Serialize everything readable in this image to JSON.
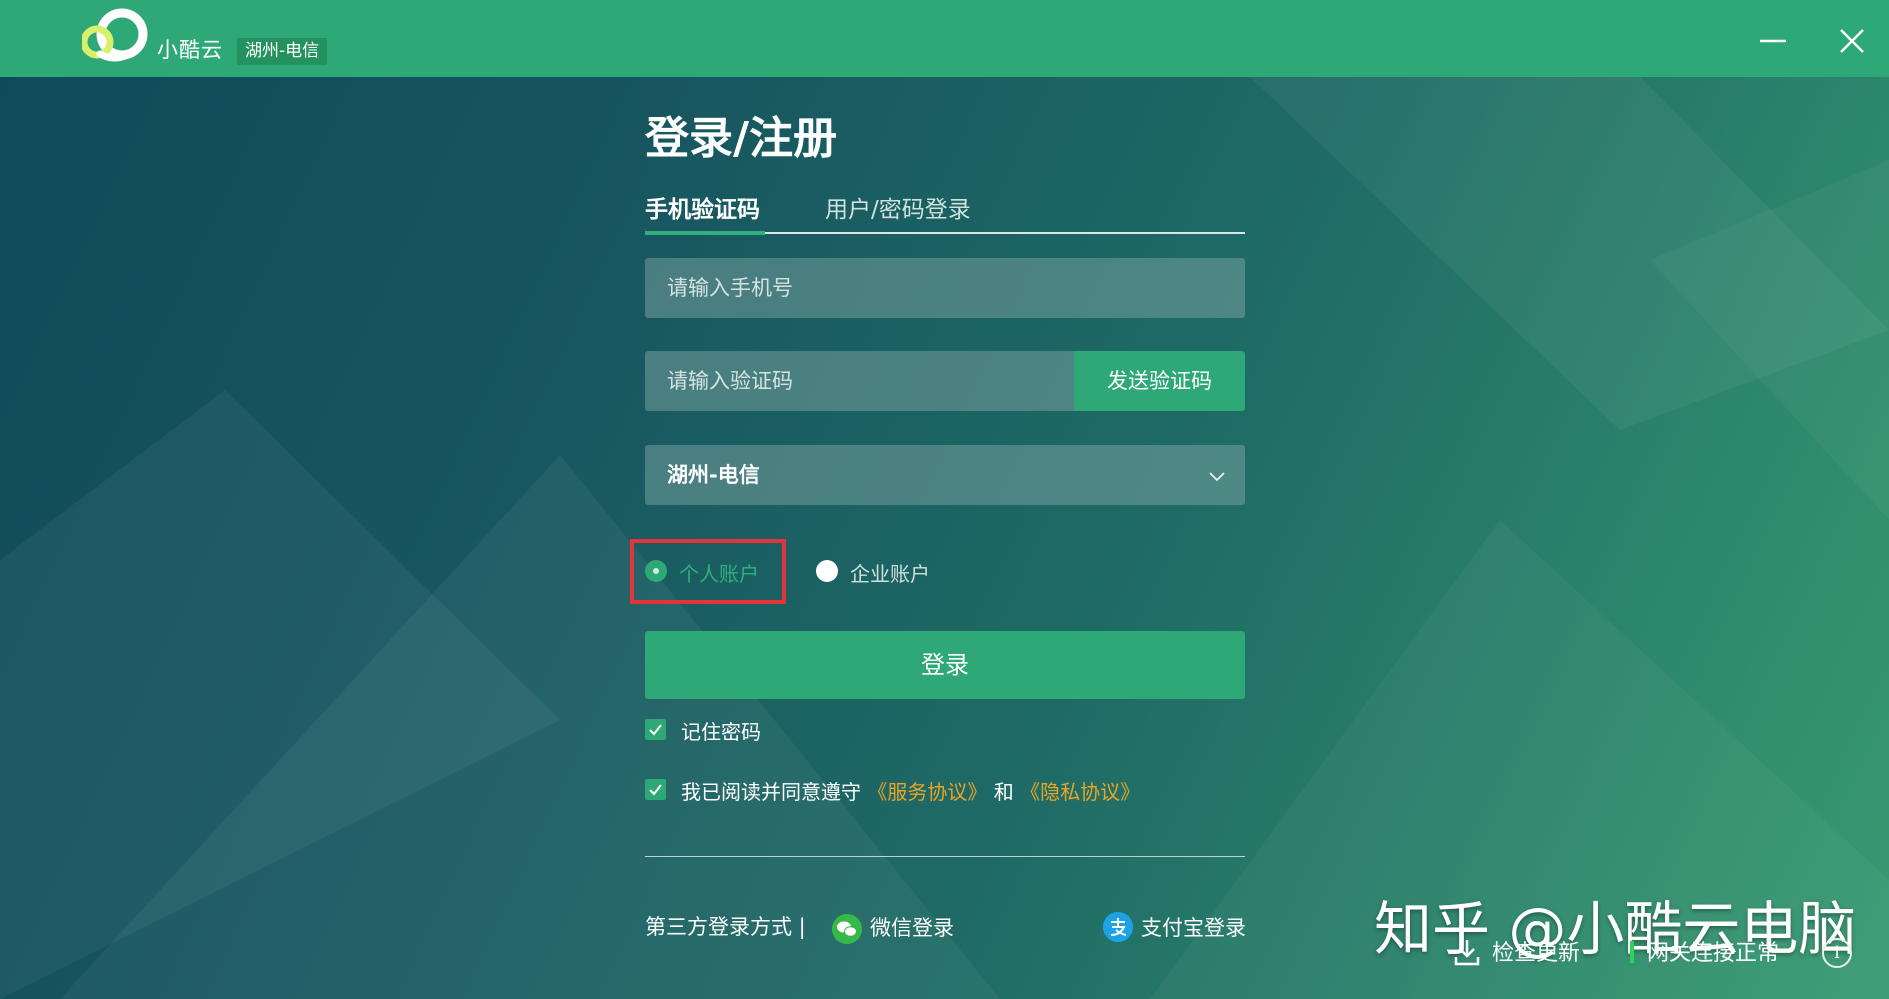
{
  "app": {
    "brand": "小酷云",
    "region_badge": "湖州-电信"
  },
  "login": {
    "title": "登录/注册",
    "tabs": [
      {
        "label": "手机验证码",
        "active": true
      },
      {
        "label": "用户/密码登录",
        "active": false
      }
    ],
    "phone_placeholder": "请输入手机号",
    "code_placeholder": "请输入验证码",
    "send_code_label": "发送验证码",
    "region_value": "湖州-电信",
    "account_types": [
      {
        "label": "个人账户",
        "selected": true
      },
      {
        "label": "企业账户",
        "selected": false
      }
    ],
    "login_label": "登录",
    "remember_label": "记住密码",
    "agree": {
      "prefix": "我已阅读并同意遵守",
      "service_link": "《服务协议》",
      "and": "和",
      "privacy_link": "《隐私协议》"
    },
    "third_party": {
      "label": "第三方登录方式 |",
      "wechat": "微信登录",
      "alipay": "支付宝登录"
    }
  },
  "footer": {
    "update_label": "检查更新",
    "gateway_label": "网关连接正常",
    "info_glyph": "i"
  },
  "watermark": "知乎 @小酷云电脑",
  "colors": {
    "accent": "#2fa878",
    "titlebar": "#2fa878",
    "link": "#e8a526",
    "highlight": "#e5333a"
  }
}
